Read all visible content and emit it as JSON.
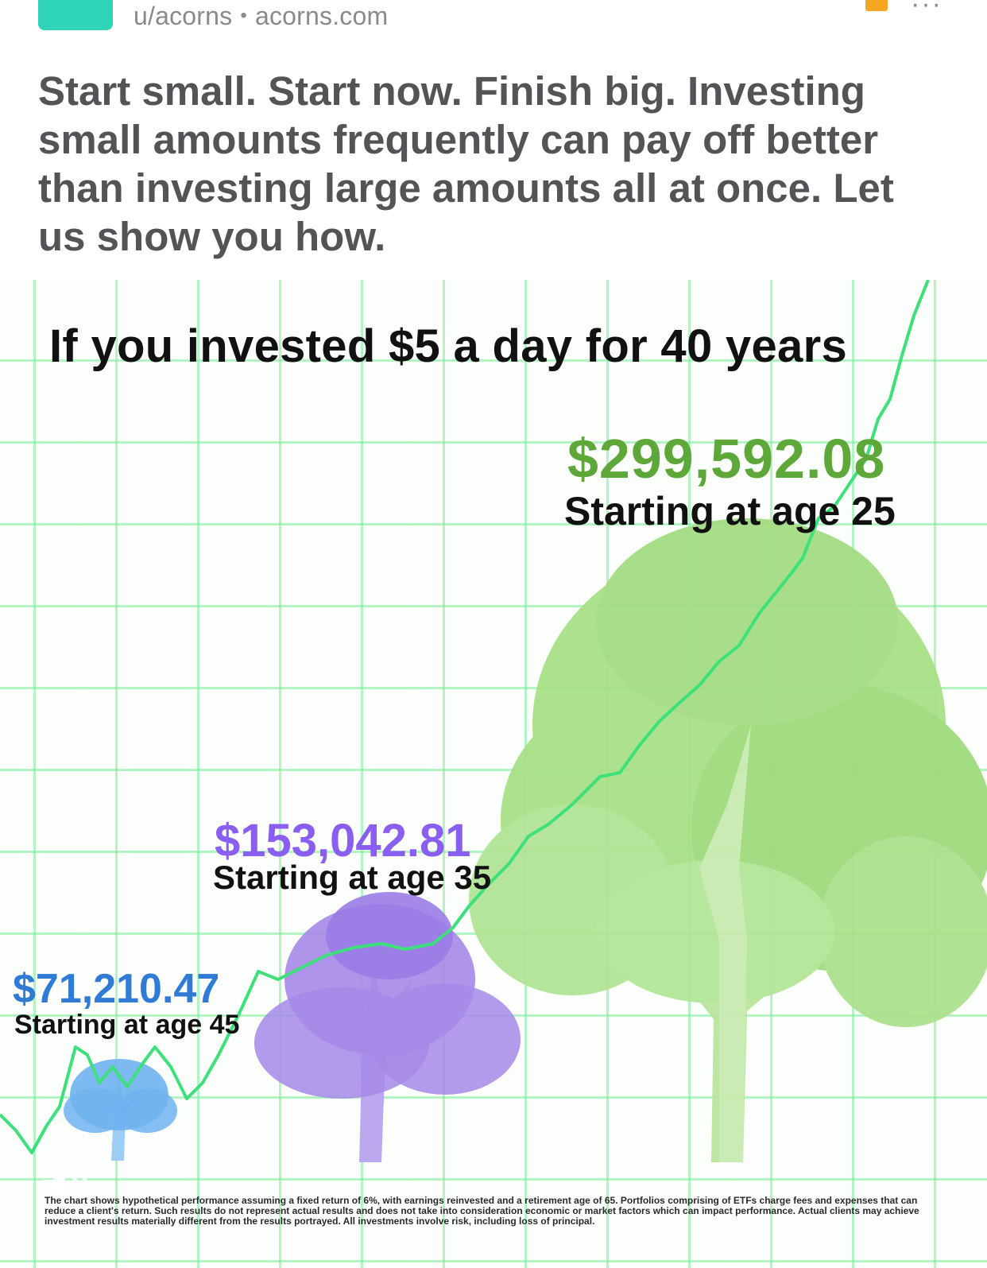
{
  "post": {
    "username": "u/acorns",
    "separator": "•",
    "domain": "acorns.com",
    "more_label": "···",
    "title": "Start small. Start now. Finish big. Investing small amounts frequently can pay off better than investing large amounts all at once. Let us show you how."
  },
  "ad": {
    "headline": "If you invested $5 a day for 40 years",
    "scenarios": [
      {
        "amount": "$299,592.08",
        "label": "Starting at age 25",
        "color": "#5ea83a",
        "tree_color": "#95d872"
      },
      {
        "amount": "$153,042.81",
        "label": "Starting at age 35",
        "color": "#8a5ef0",
        "tree_color": "#a58ae8"
      },
      {
        "amount": "$71,210.47",
        "label": "Starting at age 45",
        "color": "#2f7bd6",
        "tree_color": "#6fb3f0"
      }
    ],
    "disclaimer": "The chart shows hypothetical performance assuming a fixed return of 6%, with earnings reinvested and a retirement age of 65. Portfolios comprising of ETFs charge fees and expenses that can reduce a client's return. Such results do not represent actual results and does not take into consideration economic or market factors which can impact performance. Actual clients may achieve investment results materially different from the results portrayed. All investments involve risk, including loss of principal.",
    "line_color": "#3de07a",
    "grid_color": "#8eeca8"
  },
  "icons": {
    "avatar": "acorn-logo",
    "sound": "speaker-icon"
  }
}
